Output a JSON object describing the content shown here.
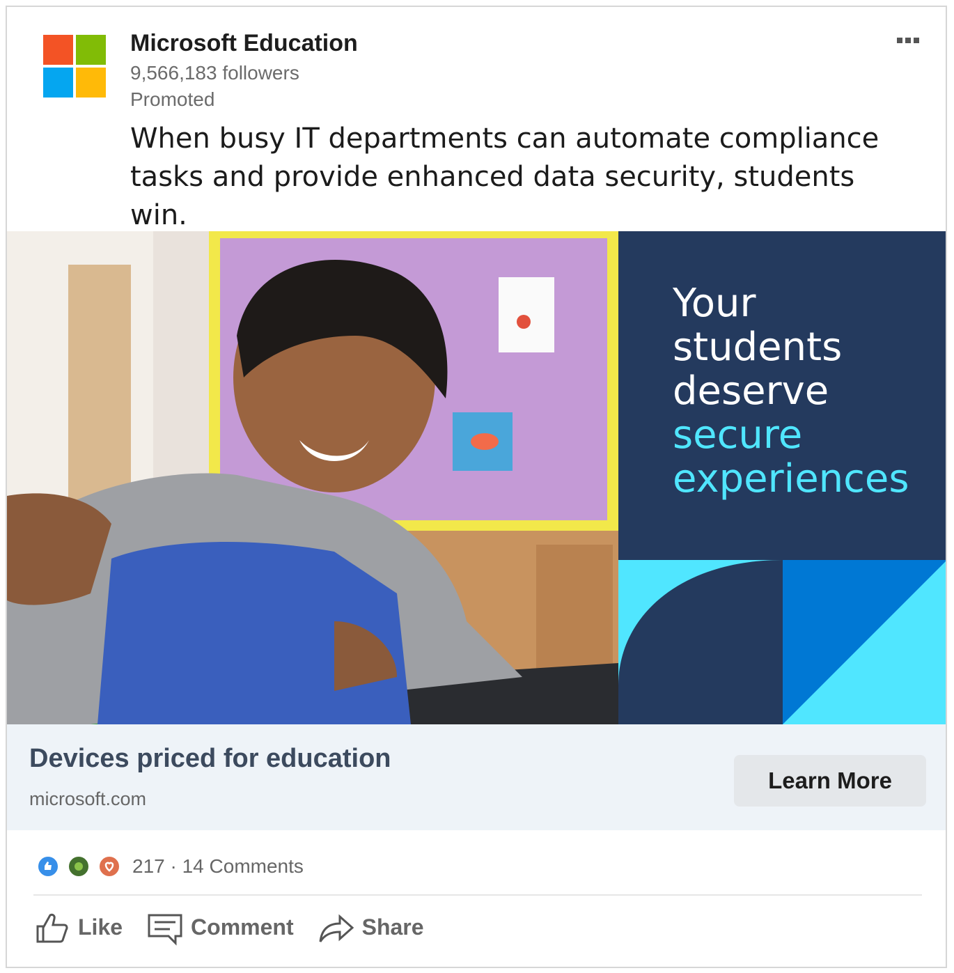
{
  "post": {
    "company": "Microsoft Education",
    "followers": "9,566,183 followers",
    "promoted": "Promoted",
    "text": "When busy IT departments can automate compliance tasks and provide enhanced data security, students win."
  },
  "banner": {
    "line1": "Your",
    "line2": "students",
    "line3": "deserve",
    "line4": "secure",
    "line5": "experiences"
  },
  "cta": {
    "title": "Devices priced for education",
    "domain": "microsoft.com",
    "button": "Learn More"
  },
  "social": {
    "counts": "217 · 14 Comments"
  },
  "actions": {
    "like": "Like",
    "comment": "Comment",
    "share": "Share"
  },
  "colors": {
    "panel": "#243a5e",
    "accent_cyan": "#50e6ff",
    "accent_blue": "#0078d4",
    "cta_bg": "#eef3f8"
  }
}
